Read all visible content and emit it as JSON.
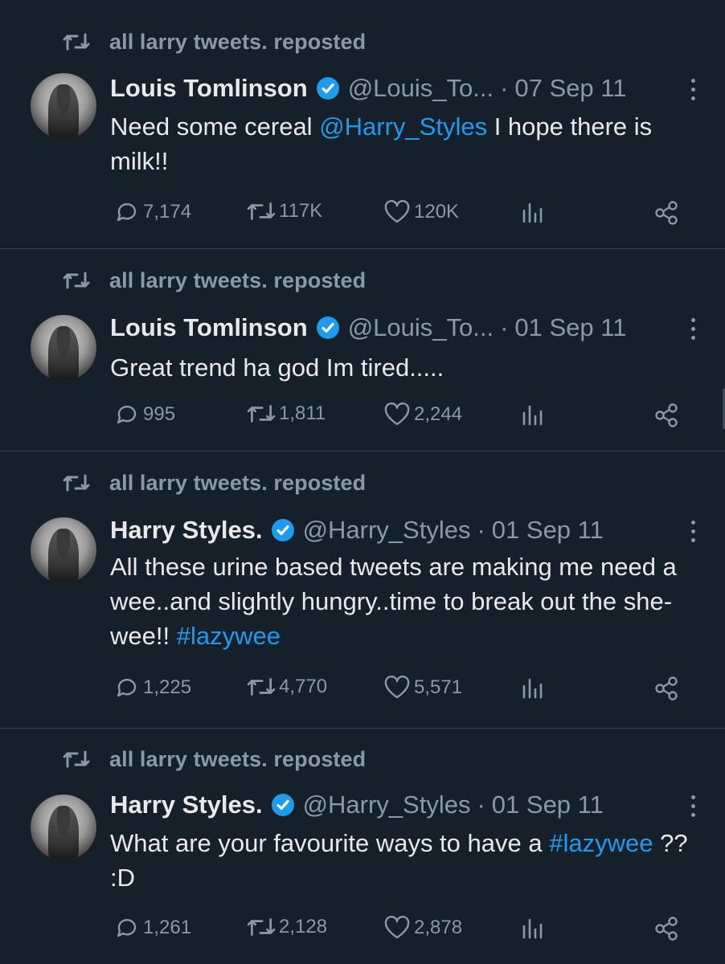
{
  "tweets": [
    {
      "repost_label": "all larry tweets. reposted",
      "author": "Louis Tomlinson",
      "handle": "@Louis_To...",
      "sep": "·",
      "date": "07 Sep 11",
      "text_parts": [
        {
          "t": "Need some cereal ",
          "link": false
        },
        {
          "t": "@Harry_Styles",
          "link": true
        },
        {
          "t": " I hope there is milk!!",
          "link": false
        }
      ],
      "replies": "7,174",
      "reposts": "117K",
      "likes": "120K"
    },
    {
      "repost_label": "all larry tweets. reposted",
      "author": "Louis Tomlinson",
      "handle": "@Louis_To...",
      "sep": "·",
      "date": "01 Sep 11",
      "text_parts": [
        {
          "t": "Great trend ha god Im tired.....",
          "link": false
        }
      ],
      "replies": "995",
      "reposts": "1,811",
      "likes": "2,244"
    },
    {
      "repost_label": "all larry tweets. reposted",
      "author": "Harry Styles.",
      "handle": "@Harry_Styles",
      "sep": "·",
      "date": "01 Sep 11",
      "text_parts": [
        {
          "t": "All these urine based tweets are making me need a wee..and slightly hungry..time to break out the she-wee!!  ",
          "link": false
        },
        {
          "t": "#lazywee",
          "link": true
        }
      ],
      "replies": "1,225",
      "reposts": "4,770",
      "likes": "5,571"
    },
    {
      "repost_label": "all larry tweets. reposted",
      "author": "Harry Styles.",
      "handle": "@Harry_Styles",
      "sep": "·",
      "date": "01 Sep 11",
      "text_parts": [
        {
          "t": "What are your favourite ways to have a ",
          "link": false
        },
        {
          "t": "#lazywee",
          "link": true
        },
        {
          "t": " ?? :D",
          "link": false
        }
      ],
      "replies": "1,261",
      "reposts": "2,128",
      "likes": "2,878"
    }
  ],
  "icons": {
    "repost": "repost-icon",
    "verified": "verified-badge-icon",
    "more": "more-options-icon",
    "reply": "reply-icon",
    "like": "like-icon",
    "views": "views-icon",
    "share": "share-icon"
  },
  "colors": {
    "background": "#15202b",
    "text": "#e7e9ea",
    "muted": "#8b98a5",
    "accent": "#1d9bf0",
    "divider": "#38444d"
  }
}
